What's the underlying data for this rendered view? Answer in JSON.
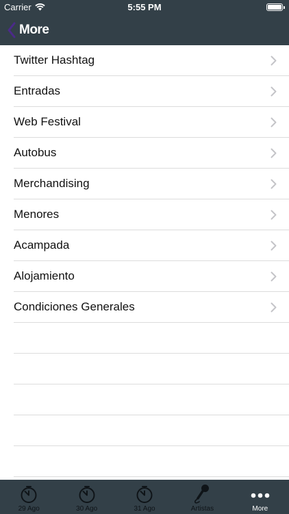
{
  "status_bar": {
    "carrier": "Carrier",
    "time": "5:55 PM"
  },
  "nav": {
    "back_label": "More"
  },
  "menu": {
    "items": [
      {
        "label": "Twitter Hashtag"
      },
      {
        "label": "Entradas"
      },
      {
        "label": "Web Festival"
      },
      {
        "label": "Autobus"
      },
      {
        "label": "Merchandising"
      },
      {
        "label": "Menores"
      },
      {
        "label": "Acampada"
      },
      {
        "label": "Alojamiento"
      },
      {
        "label": "Condiciones Generales"
      }
    ]
  },
  "tabs": [
    {
      "label": "29 Ago",
      "icon": "stopwatch-icon"
    },
    {
      "label": "30 Ago",
      "icon": "stopwatch-icon"
    },
    {
      "label": "31 Ago",
      "icon": "stopwatch-icon"
    },
    {
      "label": "Artistas",
      "icon": "microphone-icon"
    },
    {
      "label": "More",
      "icon": "more-dots-icon",
      "active": true
    }
  ],
  "colors": {
    "bar_background": "#334048",
    "back_chevron": "#4b2a8a",
    "active_tab": "#ffffff",
    "inactive_tab": "#0f1418"
  }
}
